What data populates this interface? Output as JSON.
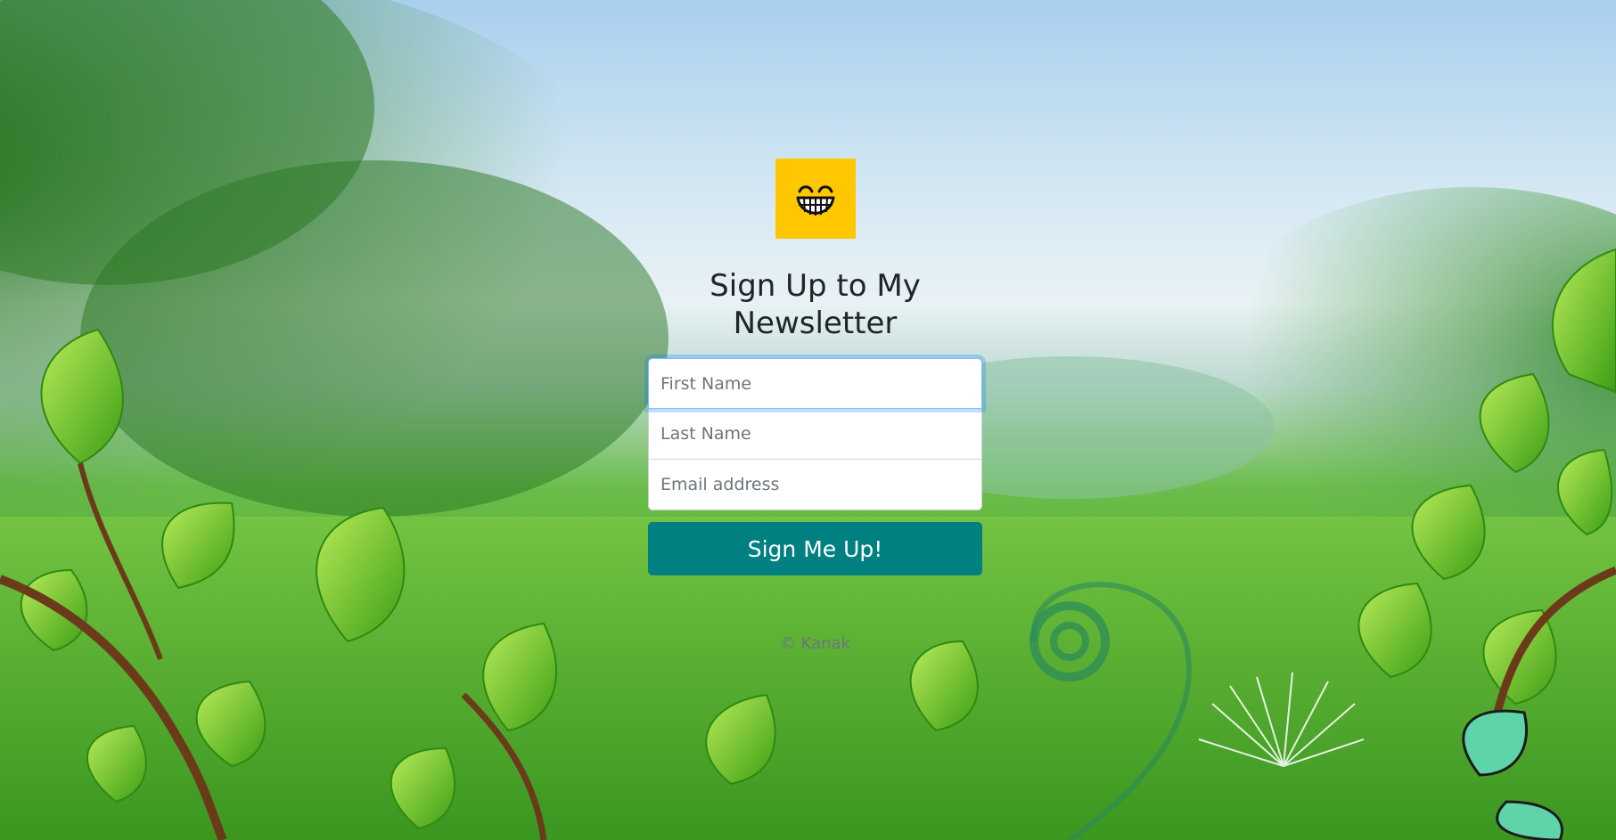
{
  "form": {
    "title": "Sign Up to My Newsletter",
    "first_name_placeholder": "First Name",
    "last_name_placeholder": "Last Name",
    "email_placeholder": "Email address",
    "submit_label": "Sign Me Up!"
  },
  "footer": {
    "copyright": "© Kanak"
  },
  "colors": {
    "logo_bg": "#ffc700",
    "button_bg": "#008080",
    "focus_ring": "#80bdff"
  },
  "icons": {
    "logo": "grinning-face-icon"
  }
}
